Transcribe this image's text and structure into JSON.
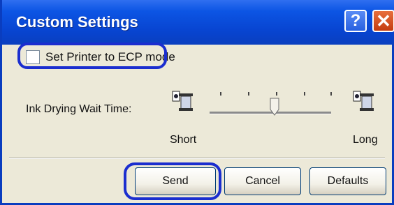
{
  "window": {
    "title": "Custom Settings"
  },
  "titlebar_buttons": {
    "help": "?",
    "close": "✕"
  },
  "ecp": {
    "label": "Set Printer to ECP mode",
    "checked": false
  },
  "ink": {
    "label": "Ink Drying Wait Time:",
    "min_label": "Short",
    "max_label": "Long",
    "level": 0.5
  },
  "buttons": {
    "send": "Send",
    "cancel": "Cancel",
    "defaults": "Defaults"
  },
  "colors": {
    "title_bar": "#0c55e4",
    "highlight": "#1b2ecf",
    "dialog_bg": "#ece9d8"
  }
}
